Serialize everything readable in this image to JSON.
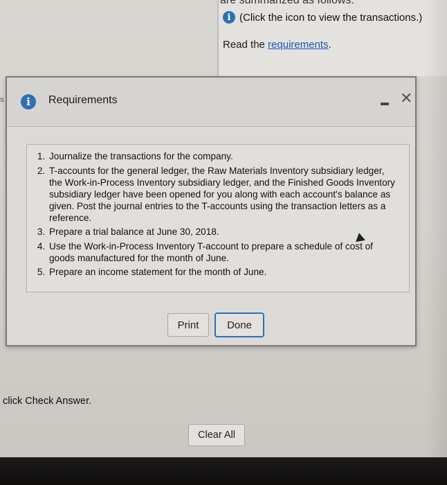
{
  "background": {
    "cut_heading": "are summarized as follows:",
    "info_text": "(Click the icon to view the transactions.)",
    "read_prefix": "Read the ",
    "requirements_link": "requirements",
    "read_suffix": ".",
    "edge_char": "s",
    "check_answer_text": "click Check Answer.",
    "clear_all_label": "Clear All"
  },
  "dialog": {
    "title": "Requirements",
    "requirements": [
      "Journalize the transactions for the company.",
      "T-accounts for the general ledger, the Raw Materials Inventory subsidiary ledger, the Work-in-Process Inventory subsidiary ledger, and the Finished Goods Inventory subsidiary ledger have been opened for you along with each account's balance as given. Post the journal entries to the T-accounts using the transaction letters as a reference.",
      "Prepare a trial balance at June 30, 2018.",
      "Use the Work-in-Process Inventory T-account to prepare a schedule of cost of goods manufactured for the month of June.",
      "Prepare an income statement for the month of June."
    ],
    "print_label": "Print",
    "done_label": "Done"
  },
  "icons": {
    "info": "info-icon",
    "minimize": "minimize-icon",
    "close": "close-icon"
  },
  "colors": {
    "accent": "#2f6fb3",
    "link": "#1a56b8"
  }
}
